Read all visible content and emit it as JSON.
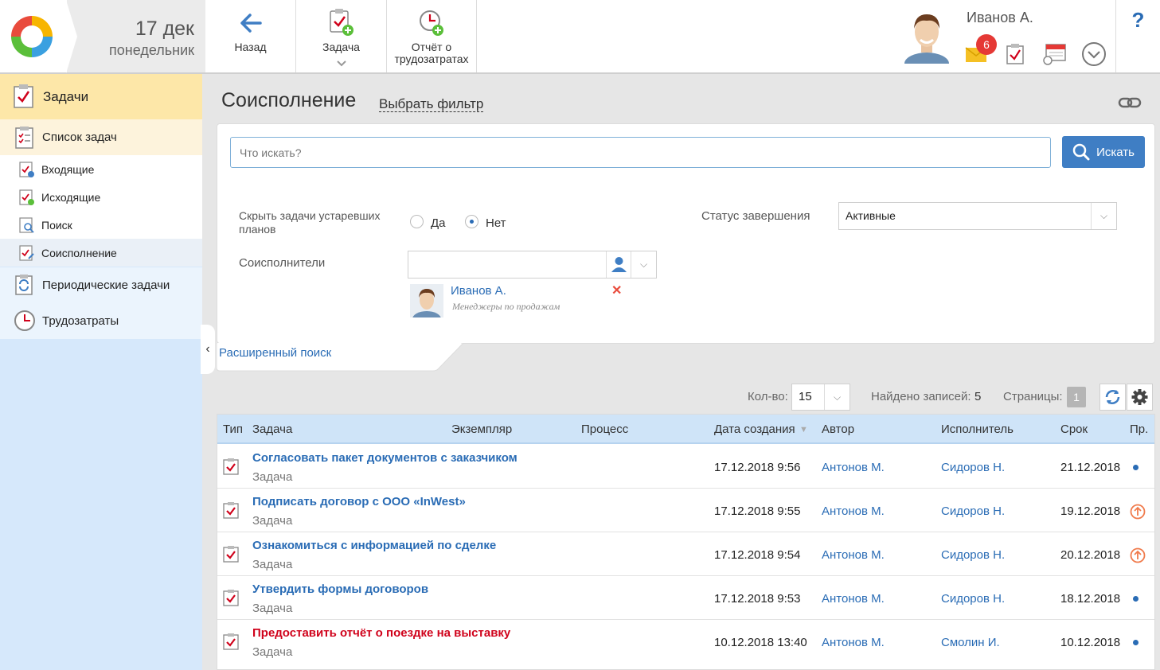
{
  "header": {
    "date_day": "17 дек",
    "date_weekday": "понедельник",
    "back_label": "Назад",
    "task_label": "Задача",
    "report_label_1": "Отчёт о",
    "report_label_2": "трудозатратах",
    "user_name": "Иванов А.",
    "mail_badge": "6",
    "help": "?"
  },
  "sidebar": {
    "main": "Задачи",
    "list": "Список задач",
    "sub": [
      "Входящие",
      "Исходящие",
      "Поиск",
      "Соисполнение"
    ],
    "periodic": "Периодические задачи",
    "labor": "Трудозатраты"
  },
  "page": {
    "title": "Соисполнение",
    "filter": "Выбрать фильтр"
  },
  "search": {
    "placeholder": "Что искать?",
    "button": "Искать"
  },
  "filters": {
    "hide_label_1": "Скрыть задачи устаревших",
    "hide_label_2": "планов",
    "yes": "Да",
    "no": "Нет",
    "status_label": "Статус завершения",
    "status_value": "Активные",
    "co_label": "Соисполнители",
    "co_name": "Иванов А.",
    "co_role": "Менеджеры по продажам",
    "advanced": "Расширенный поиск"
  },
  "pager": {
    "count_label": "Кол-во:",
    "count_value": "15",
    "found_label": "Найдено записей:",
    "found_value": "5",
    "pages_label": "Страницы:",
    "page_value": "1"
  },
  "grid": {
    "headers": [
      "Тип",
      "Задача",
      "Экземпляр",
      "Процесс",
      "Дата создания",
      "Автор",
      "Исполнитель",
      "Срок",
      "Пр."
    ],
    "rows": [
      {
        "title": "Согласовать пакет документов с заказчиком",
        "type": "Задача",
        "created": "17.12.2018 9:56",
        "author": "Антонов М.",
        "executor": "Сидоров Н.",
        "due": "21.12.2018",
        "priority": "normal"
      },
      {
        "title": "Подписать договор с ООО «InWest»",
        "type": "Задача",
        "created": "17.12.2018 9:55",
        "author": "Антонов М.",
        "executor": "Сидоров Н.",
        "due": "19.12.2018",
        "priority": "high"
      },
      {
        "title": "Ознакомиться с информацией по сделке",
        "type": "Задача",
        "created": "17.12.2018 9:54",
        "author": "Антонов М.",
        "executor": "Сидоров Н.",
        "due": "20.12.2018",
        "priority": "high"
      },
      {
        "title": "Утвердить формы договоров",
        "type": "Задача",
        "created": "17.12.2018 9:53",
        "author": "Антонов М.",
        "executor": "Сидоров Н.",
        "due": "18.12.2018",
        "priority": "normal"
      },
      {
        "title": "Предоставить отчёт о поездке на выставку",
        "type": "Задача",
        "created": "10.12.2018 13:40",
        "author": "Антонов М.",
        "executor": "Смолин И.",
        "due": "10.12.2018",
        "priority": "normal",
        "overdue": true
      }
    ]
  },
  "colors": {
    "accent": "#2a6cb5",
    "overdue": "#d0021b",
    "sidebar": "#d6e8fb",
    "highlight": "#fde7a8"
  }
}
